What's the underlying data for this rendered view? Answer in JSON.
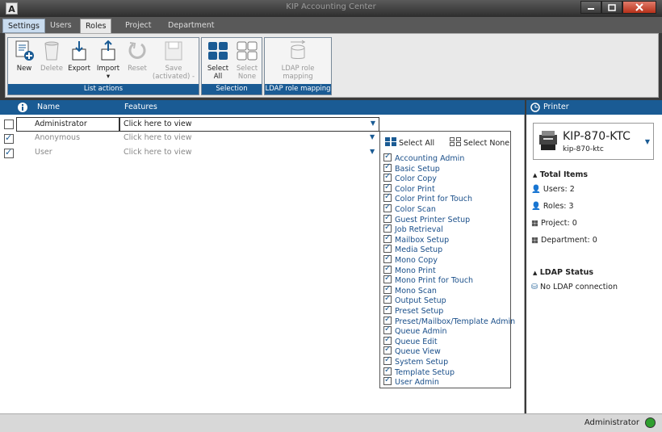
{
  "window": {
    "app_icon": "A",
    "title": "KIP Accounting Center"
  },
  "tabs": [
    "Settings",
    "Users",
    "Roles",
    "Project",
    "Department"
  ],
  "ribbon": {
    "list_actions": {
      "label": "List actions",
      "buttons": [
        {
          "label": "New",
          "icon": "new-icon"
        },
        {
          "label": "Delete",
          "icon": "delete-icon"
        },
        {
          "label": "Export",
          "icon": "export-icon"
        },
        {
          "label": "Import",
          "icon": "import-icon",
          "sub": "▾"
        },
        {
          "label": "Reset",
          "icon": "reset-icon"
        },
        {
          "label": "Save",
          "icon": "save-icon",
          "sub": "(activated)"
        }
      ]
    },
    "selection": {
      "label": "Selection",
      "buttons": [
        {
          "label": "Select",
          "sub": "All",
          "icon": "select-all-icon"
        },
        {
          "label": "Select",
          "sub": "None",
          "icon": "select-none-icon"
        }
      ]
    },
    "ldap": {
      "label": "LDAP role mapping",
      "button": {
        "label": "LDAP role",
        "sub": "mapping",
        "icon": "ldap-icon"
      }
    }
  },
  "table": {
    "headers": {
      "info": "i",
      "name": "Name",
      "features": "Features"
    },
    "rows": [
      {
        "checked": false,
        "name": "Administrator",
        "features": "Click here to view"
      },
      {
        "checked": true,
        "name": "Anonymous",
        "features": "Click here to view"
      },
      {
        "checked": true,
        "name": "User",
        "features": "Click here to view"
      }
    ]
  },
  "features_popup": {
    "select_all": "Select All",
    "select_none": "Select None",
    "items": [
      "Accounting Admin",
      "Basic Setup",
      "Color Copy",
      "Color Print",
      "Color Print for Touch",
      "Color Scan",
      "Guest Printer Setup",
      "Job Retrieval",
      "Mailbox Setup",
      "Media Setup",
      "Mono Copy",
      "Mono Print",
      "Mono Print for Touch",
      "Mono Scan",
      "Output Setup",
      "Preset Setup",
      "Preset/Mailbox/Template Admin",
      "Queue Admin",
      "Queue Edit",
      "Queue View",
      "System Setup",
      "Template Setup",
      "User Admin"
    ]
  },
  "printer_panel": {
    "header": "Printer",
    "name": "KIP-870-KTC",
    "host": "kip-870-ktc",
    "total_items_title": "Total Items",
    "users": "Users: 2",
    "roles": "Roles: 3",
    "project": "Project: 0",
    "department": "Department: 0",
    "ldap_title": "LDAP Status",
    "ldap_status": "No LDAP connection"
  },
  "status": {
    "user": "Administrator",
    "indicator_color": "#2e9e2e"
  },
  "colors": {
    "accent": "#1a5b94"
  }
}
